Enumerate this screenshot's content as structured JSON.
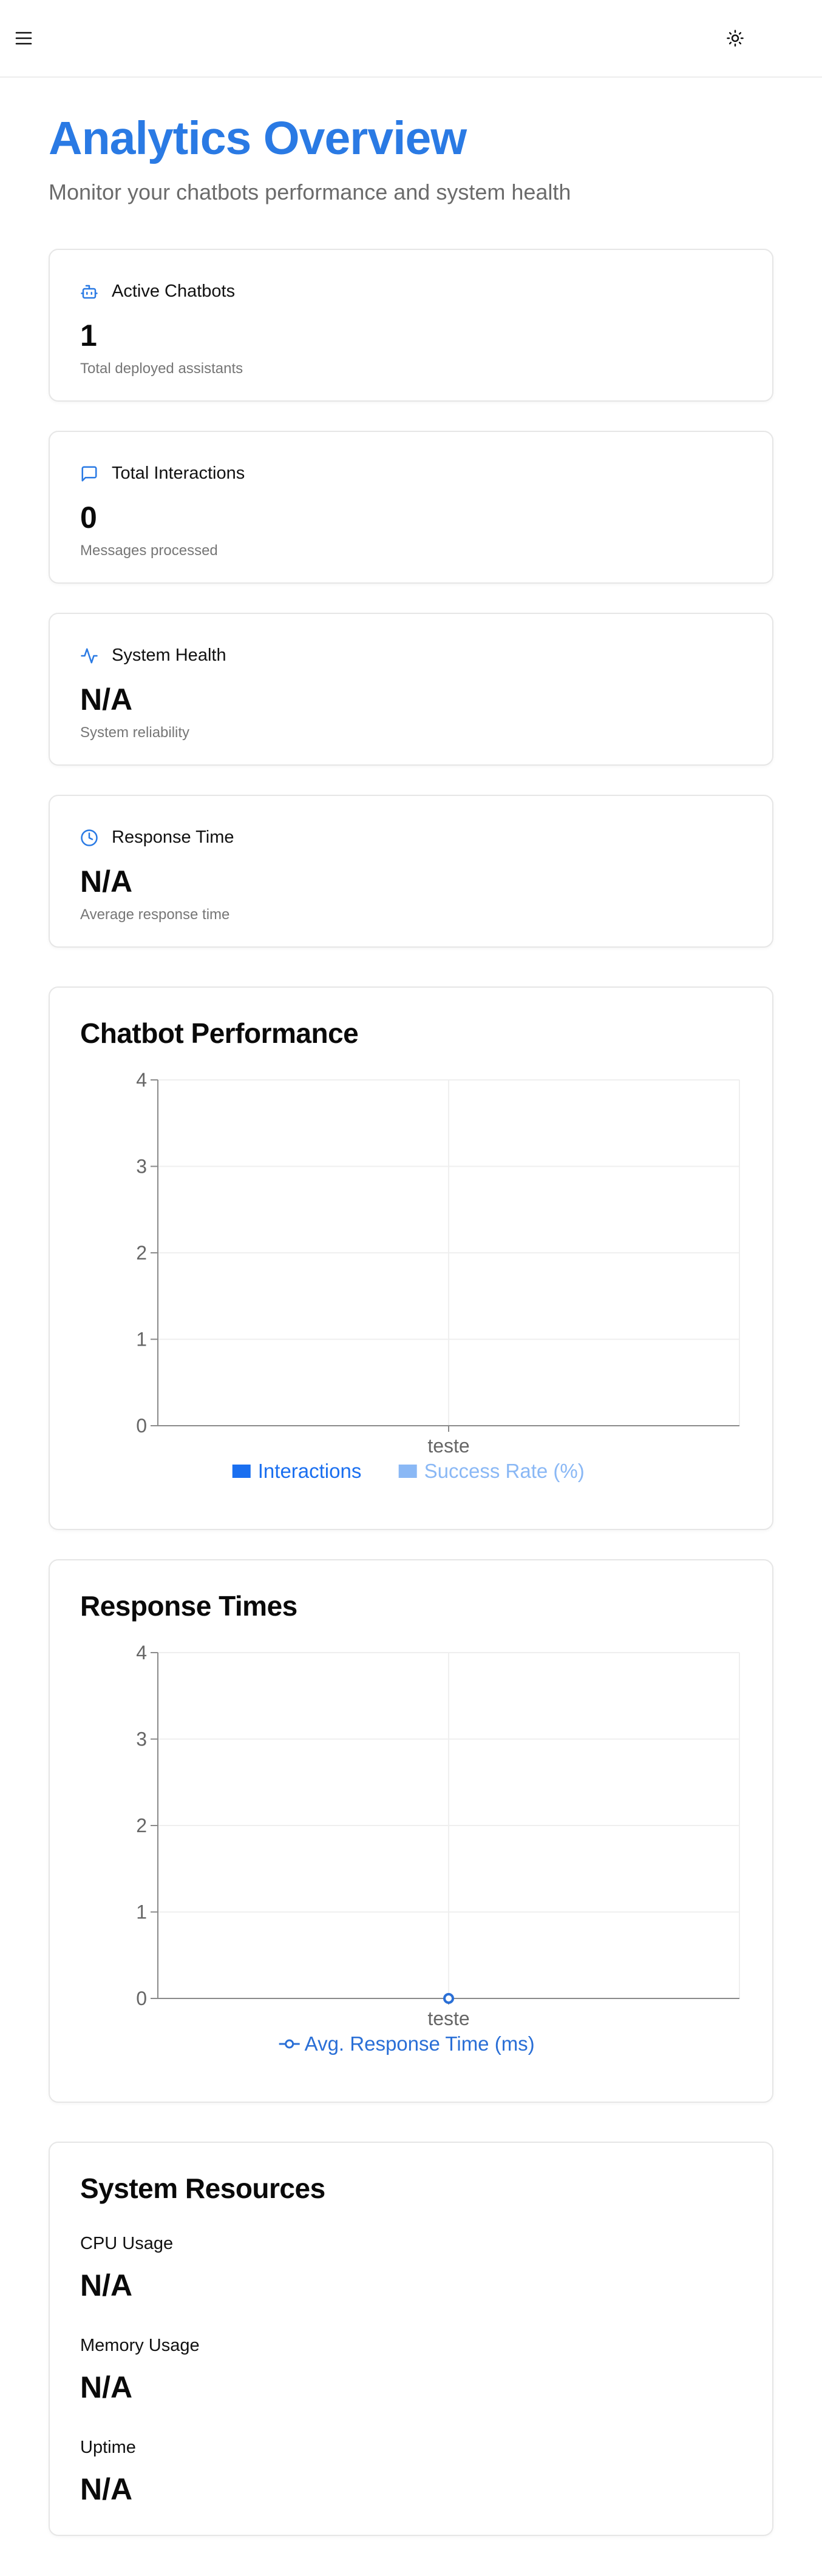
{
  "header": {
    "menu_icon": "menu-icon",
    "theme_icon": "sun-icon"
  },
  "page": {
    "title": "Analytics Overview",
    "subtitle": "Monitor your chatbots performance and system health"
  },
  "stats": [
    {
      "icon": "bot-icon",
      "title": "Active Chatbots",
      "value": "1",
      "description": "Total deployed assistants"
    },
    {
      "icon": "message-square-icon",
      "title": "Total Interactions",
      "value": "0",
      "description": "Messages processed"
    },
    {
      "icon": "activity-icon",
      "title": "System Health",
      "value": "N/A",
      "description": "System reliability"
    },
    {
      "icon": "clock-icon",
      "title": "Response Time",
      "value": "N/A",
      "description": "Average response time"
    }
  ],
  "performance": {
    "title": "Chatbot Performance",
    "chart_data": {
      "type": "bar",
      "categories": [
        "teste"
      ],
      "series": [
        {
          "name": "Interactions",
          "values": [
            0
          ],
          "color": "#1a6ff0"
        },
        {
          "name": "Success Rate (%)",
          "values": [
            0
          ],
          "color": "#8ab8f5"
        }
      ],
      "ylim": [
        0,
        4
      ],
      "yticks": [
        "0",
        "1",
        "2",
        "3",
        "4"
      ],
      "grid": true,
      "legend": "bottom"
    }
  },
  "response_times": {
    "title": "Response Times",
    "chart_data": {
      "type": "line",
      "categories": [
        "teste"
      ],
      "series": [
        {
          "name": "Avg. Response Time (ms)",
          "values": [
            0
          ],
          "color": "#2a6fd6"
        }
      ],
      "ylim": [
        0,
        4
      ],
      "yticks": [
        "0",
        "1",
        "2",
        "3",
        "4"
      ],
      "grid": true,
      "legend": "bottom"
    }
  },
  "resources": {
    "title": "System Resources",
    "items": [
      {
        "label": "CPU Usage",
        "value": "N/A"
      },
      {
        "label": "Memory Usage",
        "value": "N/A"
      },
      {
        "label": "Uptime",
        "value": "N/A"
      }
    ]
  }
}
